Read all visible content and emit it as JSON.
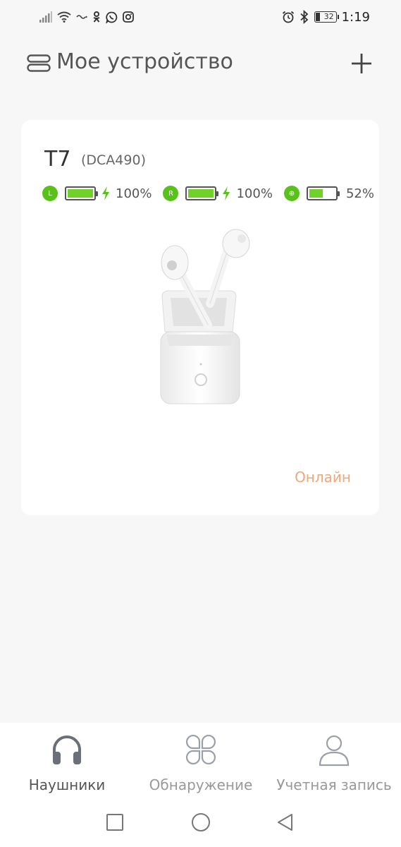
{
  "status_bar": {
    "icons": [
      "signal-icon",
      "wifi-icon",
      "nfc-icon",
      "odnoklassniki-icon",
      "whatsapp-icon",
      "instagram-icon"
    ],
    "right_icons": [
      "alarm-icon",
      "bluetooth-icon"
    ],
    "battery_level": "32",
    "time": "1:19"
  },
  "header": {
    "title": "Мое устройство",
    "menu_icon": "device-list-icon",
    "add_icon": "plus-icon"
  },
  "device": {
    "name": "T7",
    "model": "(DCA490)",
    "left": {
      "badge": "L",
      "percent": "100%",
      "level": 1.0,
      "charging": true
    },
    "right": {
      "badge": "R",
      "percent": "100%",
      "level": 1.0,
      "charging": true
    },
    "case": {
      "badge": "⊕",
      "percent": "52%",
      "level": 0.52,
      "charging": false
    },
    "status": "Онлайн",
    "accent_color": "#59c21a",
    "status_color": "#f0a87a"
  },
  "bottom_nav": {
    "items": [
      {
        "label": "Наушники",
        "icon": "headphones-icon",
        "active": true
      },
      {
        "label": "Обнаружение",
        "icon": "discover-icon",
        "active": false
      },
      {
        "label": "Учетная запись",
        "icon": "account-icon",
        "active": false
      }
    ]
  },
  "system_nav": {
    "items": [
      "recent-apps-icon",
      "home-icon",
      "back-icon"
    ]
  }
}
